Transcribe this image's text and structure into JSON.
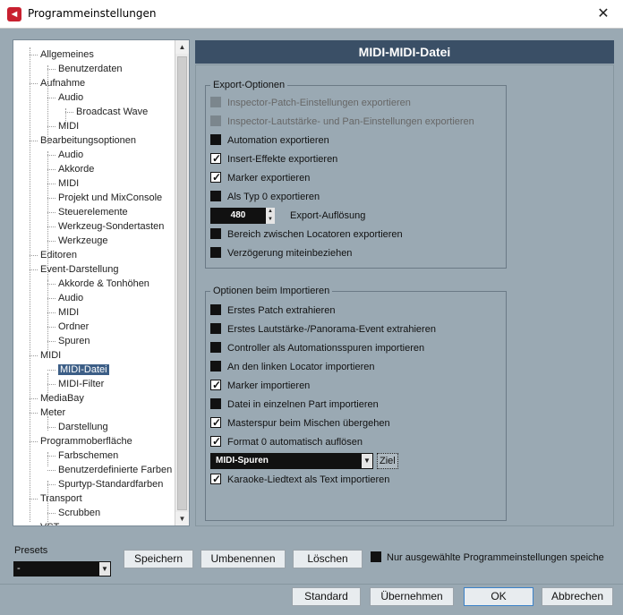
{
  "window": {
    "title": "Programmeinstellungen",
    "close_glyph": "✕"
  },
  "tree": {
    "items": [
      {
        "label": "Allgemeines"
      },
      {
        "label": "Benutzerdaten"
      },
      {
        "label": "Aufnahme"
      },
      {
        "label": "Audio"
      },
      {
        "label": "Broadcast Wave"
      },
      {
        "label": "MIDI"
      },
      {
        "label": "Bearbeitungsoptionen"
      },
      {
        "label": "Audio"
      },
      {
        "label": "Akkorde"
      },
      {
        "label": "MIDI"
      },
      {
        "label": "Projekt und MixConsole"
      },
      {
        "label": "Steuerelemente"
      },
      {
        "label": "Werkzeug-Sondertasten"
      },
      {
        "label": "Werkzeuge"
      },
      {
        "label": "Editoren"
      },
      {
        "label": "Event-Darstellung"
      },
      {
        "label": "Akkorde & Tonhöhen"
      },
      {
        "label": "Audio"
      },
      {
        "label": "MIDI"
      },
      {
        "label": "Ordner"
      },
      {
        "label": "Spuren"
      },
      {
        "label": "MIDI"
      },
      {
        "label": "MIDI-Datei"
      },
      {
        "label": "MIDI-Filter"
      },
      {
        "label": "MediaBay"
      },
      {
        "label": "Meter"
      },
      {
        "label": "Darstellung"
      },
      {
        "label": "Programmoberfläche"
      },
      {
        "label": "Farbschemen"
      },
      {
        "label": "Benutzerdefinierte Farben"
      },
      {
        "label": "Spurtyp-Standardfarben"
      },
      {
        "label": "Transport"
      },
      {
        "label": "Scrubben"
      },
      {
        "label": "VST"
      }
    ],
    "selected": "MIDI-Datei"
  },
  "panel": {
    "title": "MIDI-MIDI-Datei",
    "export": {
      "title": "Export-Optionen",
      "options": [
        {
          "label": "Inspector-Patch-Einstellungen exportieren",
          "checked": false,
          "disabled": true
        },
        {
          "label": "Inspector-Lautstärke- und Pan-Einstellungen exportieren",
          "checked": false,
          "disabled": true
        },
        {
          "label": "Automation exportieren",
          "checked": false,
          "disabled": false
        },
        {
          "label": "Insert-Effekte exportieren",
          "checked": true,
          "disabled": false
        },
        {
          "label": "Marker exportieren",
          "checked": true,
          "disabled": false
        },
        {
          "label": "Als Typ 0 exportieren",
          "checked": false,
          "disabled": false
        }
      ],
      "resolution": {
        "value": "480",
        "label": "Export-Auflösung"
      },
      "options_after": [
        {
          "label": "Bereich zwischen Locatoren exportieren",
          "checked": false
        },
        {
          "label": "Verzögerung miteinbeziehen",
          "checked": false
        }
      ]
    },
    "import": {
      "title": "Optionen beim Importieren",
      "options": [
        {
          "label": "Erstes Patch extrahieren",
          "checked": false
        },
        {
          "label": "Erstes Lautstärke-/Panorama-Event extrahieren",
          "checked": false
        },
        {
          "label": "Controller als Automationsspuren importieren",
          "checked": false
        },
        {
          "label": "An den linken Locator importieren",
          "checked": false
        },
        {
          "label": "Marker importieren",
          "checked": true
        },
        {
          "label": "Datei in einzelnen Part importieren",
          "checked": false
        },
        {
          "label": "Masterspur beim Mischen übergehen",
          "checked": true
        },
        {
          "label": "Format 0 automatisch auflösen",
          "checked": true
        }
      ],
      "destination": {
        "value": "MIDI-Spuren",
        "button": "Ziel"
      },
      "karaoke": {
        "label": "Karaoke-Liedtext als Text importieren",
        "checked": true
      }
    }
  },
  "presets": {
    "label": "Presets",
    "value": "-",
    "save": "Speichern",
    "rename": "Umbenennen",
    "delete": "Löschen",
    "only_selected": "Nur ausgewählte Programmeinstellungen speiche"
  },
  "footer": {
    "default": "Standard",
    "apply": "Übernehmen",
    "ok": "OK",
    "cancel": "Abbrechen"
  }
}
